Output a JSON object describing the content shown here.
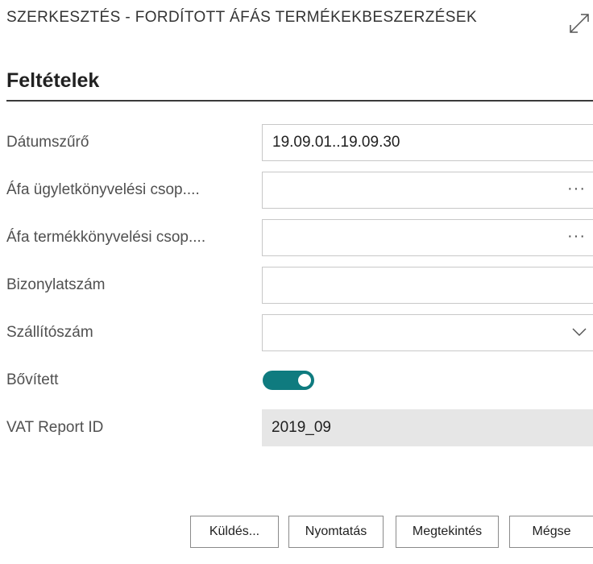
{
  "dialog": {
    "title": "SZERKESZTÉS - FORDÍTOTT ÁFÁS TERMÉKEKBESZERZÉSEK",
    "expand_icon": "expand-diagonal-arrow-icon"
  },
  "section": {
    "title": "Feltételek"
  },
  "fields": [
    {
      "label": "Dátumszűrő",
      "value": "19.09.01..19.09.30",
      "kind": "text"
    },
    {
      "label": "Áfa ügyletkönyvelési csop....",
      "value": "",
      "kind": "lookup",
      "lookup_glyph": "···"
    },
    {
      "label": "Áfa termékkönyvelési csop....",
      "value": "",
      "kind": "lookup",
      "lookup_glyph": "···"
    },
    {
      "label": "Bizonylatszám",
      "value": "",
      "kind": "text"
    },
    {
      "label": "Szállítószám",
      "value": "",
      "kind": "select",
      "icon": "chevron-down-icon"
    },
    {
      "label": "Bővített",
      "value": "on",
      "kind": "toggle"
    },
    {
      "label": "VAT Report ID",
      "value": "2019_09",
      "kind": "readonly"
    }
  ],
  "buttons": {
    "send": "Küldés...",
    "print": "Nyomtatás",
    "preview": "Megtekintés",
    "cancel": "Mégse"
  },
  "colors": {
    "toggle_on": "#0f7b7f",
    "readonly_bg": "#e6e6e6",
    "border": "#c8c8c8"
  }
}
